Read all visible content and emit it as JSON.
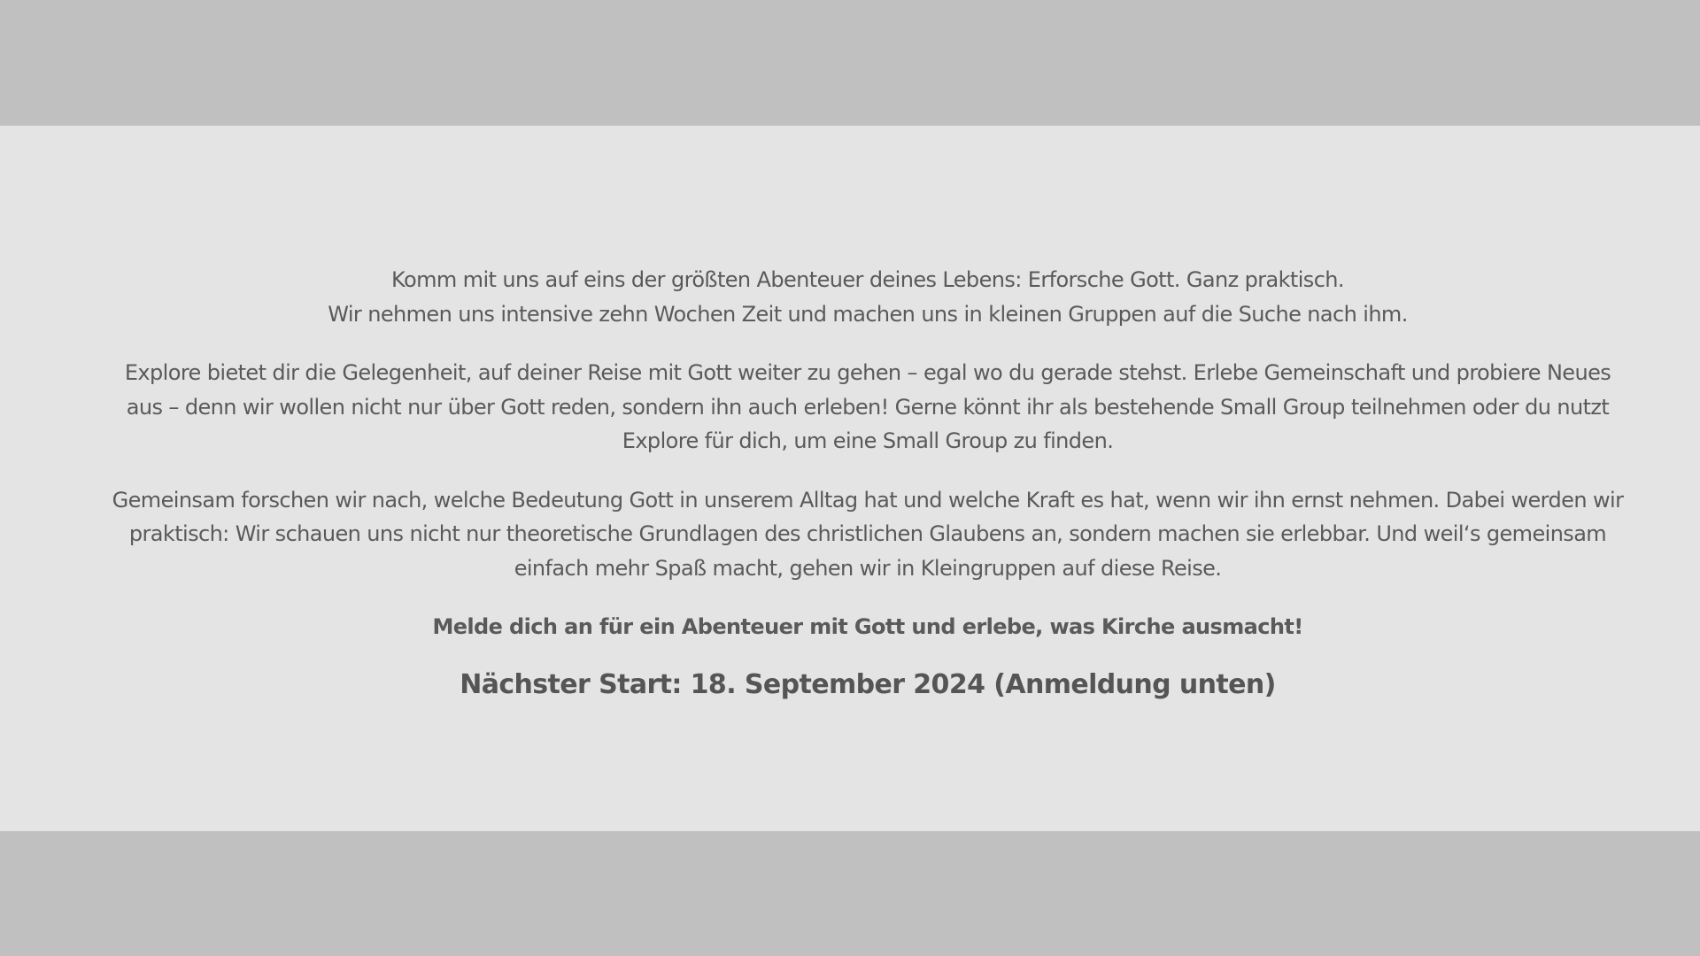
{
  "intro": {
    "line1": "Komm mit uns auf eins der größten Abenteuer deines Lebens: Erforsche Gott. Ganz praktisch.",
    "line2": "Wir nehmen uns intensive zehn Wochen Zeit und machen uns in kleinen Gruppen auf die Suche nach ihm."
  },
  "paragraph_explore": "Explore bietet dir die Gelegenheit, auf deiner Reise mit Gott weiter zu gehen – egal wo du gerade stehst. Erlebe Gemeinschaft und probiere Neues aus – denn wir wollen nicht nur über Gott reden, sondern ihn auch erleben! Gerne könnt ihr als bestehende Small Group teilnehmen oder du nutzt Explore für dich, um eine Small Group zu finden.",
  "paragraph_gemeinsam": "Gemeinsam forschen wir nach, welche Bedeutung Gott in unserem Alltag hat und welche Kraft es hat, wenn wir ihn ernst nehmen. Dabei werden wir praktisch: Wir schauen uns nicht nur theoretische Grundlagen des christlichen Glaubens an, sondern machen sie erlebbar. Und weil‘s gemeinsam einfach mehr Spaß macht, ge­hen wir in Kleingruppen auf diese Reise.",
  "call_to_action": "Melde dich an für ein Abenteuer mit Gott und erlebe, was Kirche ausmacht!",
  "next_start": "Nächster Start: 18. September 2024 (Anmeldung unten)",
  "colors": {
    "band": "#c0c0c0",
    "panel": "#e4e4e4",
    "text": "#5a5a5a"
  }
}
